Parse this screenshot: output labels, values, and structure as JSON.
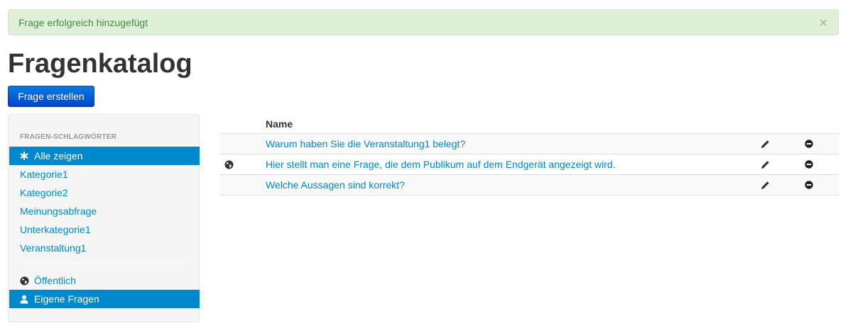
{
  "alert": {
    "message": "Frage erfolgreich hinzugefügt",
    "close_label": "×"
  },
  "page": {
    "title": "Fragenkatalog"
  },
  "toolbar": {
    "create_label": "Frage erstellen"
  },
  "sidebar": {
    "header": "FRAGEN-SCHLAGWÖRTER",
    "items": [
      {
        "label": "Alle zeigen",
        "icon": "asterisk-icon",
        "active": true
      },
      {
        "label": "Kategorie1"
      },
      {
        "label": "Kategorie2"
      },
      {
        "label": "Meinungsabfrage"
      },
      {
        "label": "Unterkategorie1"
      },
      {
        "label": "Veranstaltung1"
      }
    ],
    "filters": [
      {
        "label": "Öffentlich",
        "icon": "globe-icon",
        "active": false
      },
      {
        "label": "Eigene Fragen",
        "icon": "user-icon",
        "active": true
      }
    ]
  },
  "table": {
    "header": {
      "name": "Name"
    },
    "rows": [
      {
        "name": "Warum haben Sie die Veranstaltung1 belegt?",
        "public": false
      },
      {
        "name": "Hier stellt man eine Frage, die dem Publikum auf dem Endgerät angezeigt wird.",
        "public": true
      },
      {
        "name": "Welche Aussagen sind korrekt?",
        "public": false
      }
    ],
    "edit_icon": "pencil-icon",
    "delete_icon": "minus-circle-icon"
  },
  "colors": {
    "link": "#0088cc",
    "alert_bg": "#dff0d8",
    "alert_text": "#468847",
    "primary": "#0044cc"
  }
}
